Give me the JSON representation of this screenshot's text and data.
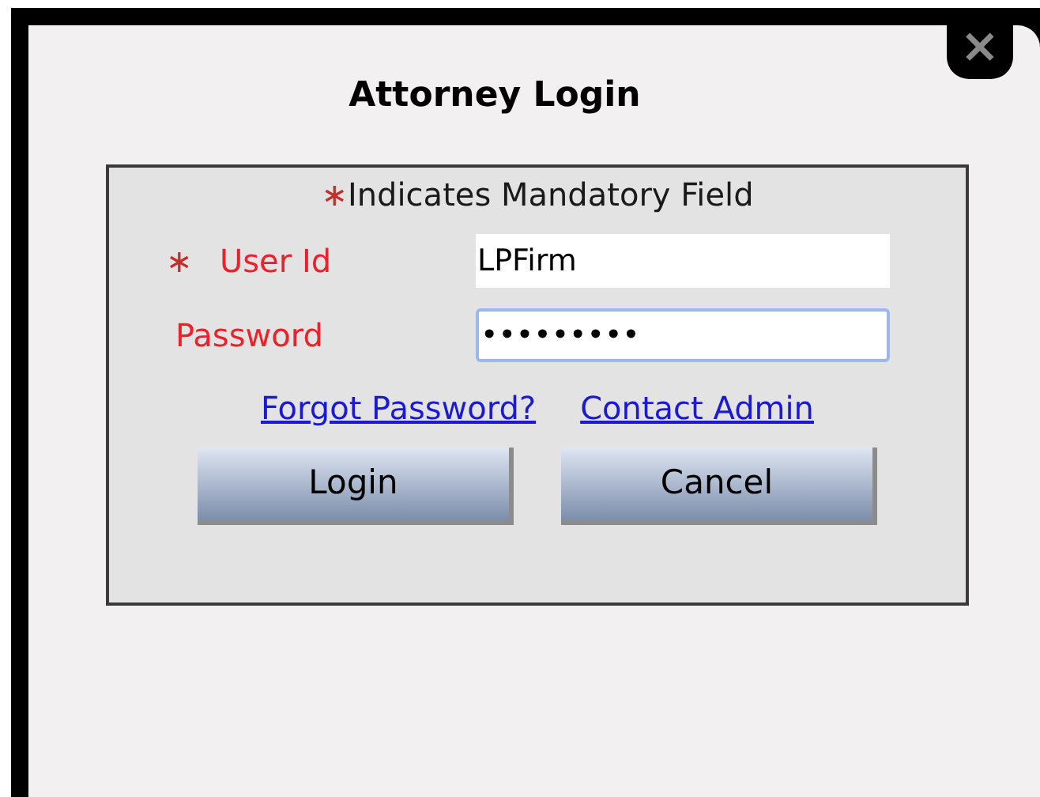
{
  "dialog": {
    "title": "Attorney Login",
    "close": "×"
  },
  "form": {
    "note_mark": "∗",
    "note": "Indicates Mandatory Field",
    "fields": [
      {
        "required_mark": "∗",
        "label": "User Id",
        "value": "LPFirm",
        "focused": false
      },
      {
        "label": "Password",
        "value": "•••••••••",
        "focused": true
      }
    ],
    "links": [
      "Forgot Password?",
      "Contact Admin"
    ],
    "buttons": [
      "Login",
      "Cancel"
    ]
  }
}
